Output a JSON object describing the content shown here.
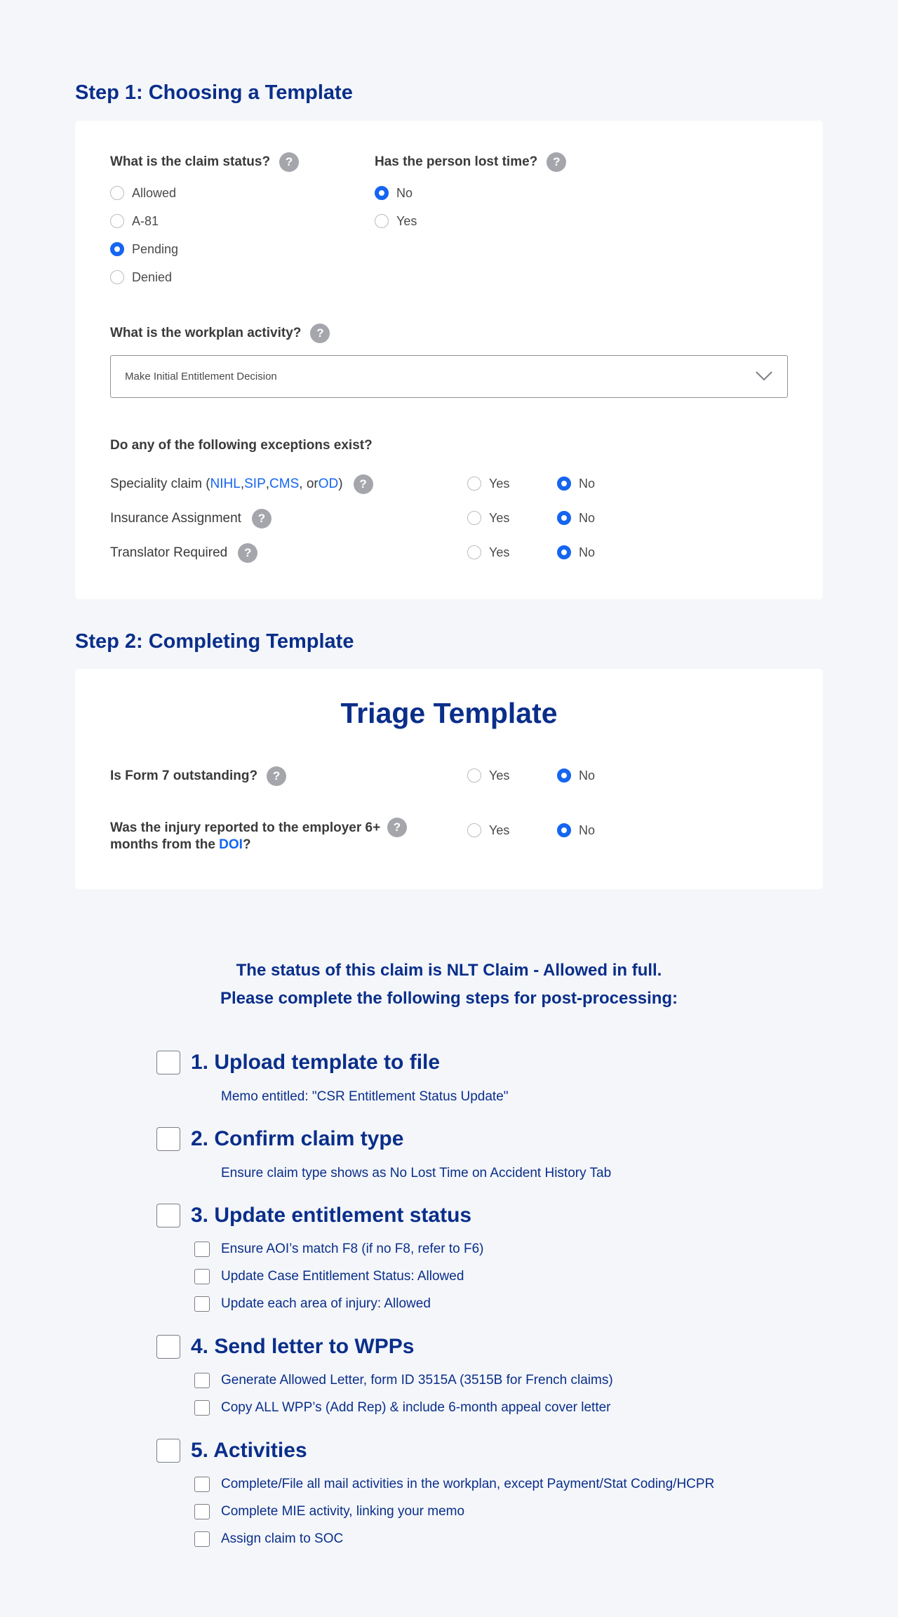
{
  "step1": {
    "heading": "Step 1: Choosing a Template",
    "claim_status": {
      "question": "What is the claim status?",
      "options": [
        "Allowed",
        "A-81",
        "Pending",
        "Denied"
      ],
      "selected": "Pending"
    },
    "lost_time": {
      "question": "Has the person lost time?",
      "options": [
        "No",
        "Yes"
      ],
      "selected": "No"
    },
    "workplan": {
      "question": "What is the workplan activity?",
      "selected_value": "Make Initial Entitlement Decision"
    },
    "exceptions": {
      "question": "Do any of the following exceptions exist?",
      "speciality": {
        "prefix": "Speciality claim (",
        "links": [
          "NIHL",
          "SIP",
          "CMS",
          "OD"
        ],
        "sep1": ", ",
        "sep2": ", ",
        "sep3": ", or ",
        "suffix": ")"
      },
      "insurance_label": "Insurance Assignment",
      "translator_label": "Translator Required",
      "yes_label": "Yes",
      "no_label": "No",
      "answers": [
        "No",
        "No",
        "No"
      ]
    }
  },
  "step2": {
    "heading": "Step 2: Completing Template",
    "triage_title": "Triage Template",
    "form7": {
      "question": "Is Form 7 outstanding?",
      "selected": "No"
    },
    "injury": {
      "question_line1": "Was the injury reported to the employer 6+",
      "question_line2_prefix": "months from the ",
      "question_link": "DOI",
      "question_suffix": "?",
      "selected": "No"
    },
    "yes_label": "Yes",
    "no_label": "No"
  },
  "status": {
    "line1": "The status of this claim is NLT Claim - Allowed in full.",
    "line2": "Please complete the following steps for post-processing:"
  },
  "post_steps": [
    {
      "title": "1. Upload template to file",
      "note": "Memo entitled: \"CSR Entitlement Status Update\""
    },
    {
      "title": "2. Confirm claim type",
      "note": "Ensure claim type shows as No Lost Time on Accident History Tab"
    },
    {
      "title": "3. Update entitlement status",
      "subs": [
        "Ensure AOI’s match F8 (if no F8, refer to F6)",
        "Update Case Entitlement Status: Allowed",
        "Update each area of injury: Allowed"
      ]
    },
    {
      "title": "4. Send letter to WPPs",
      "subs": [
        "Generate Allowed Letter, form ID 3515A (3515B for French claims)",
        "Copy ALL WPP’s (Add Rep) & include 6-month appeal cover letter"
      ]
    },
    {
      "title": "5. Activities",
      "subs": [
        "Complete/File all mail activities in the workplan, except Payment/Stat Coding/HCPR",
        "Complete MIE activity, linking your memo",
        "Assign claim to SOC"
      ]
    }
  ],
  "colors": {
    "accent": "#1565f0",
    "heading": "#0a2e8a",
    "help_icon": "#a4a6ab"
  }
}
